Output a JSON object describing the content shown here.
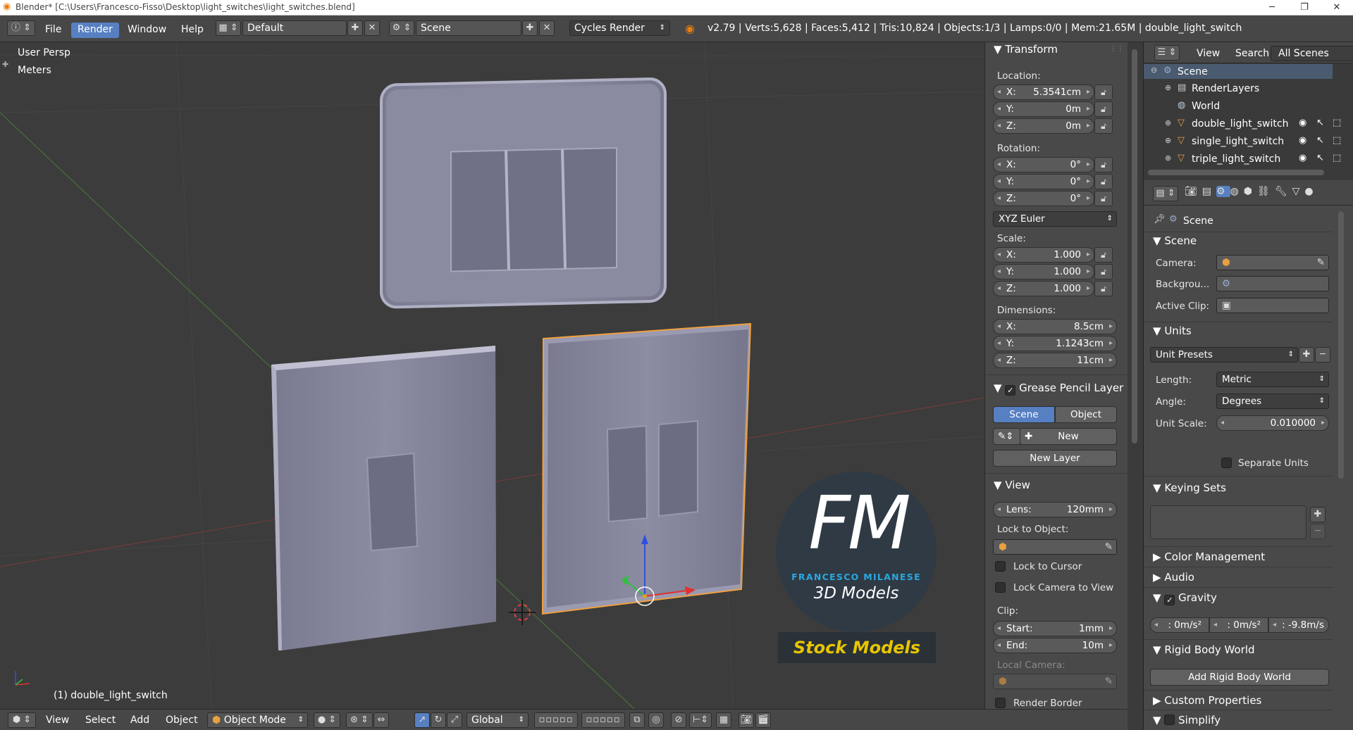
{
  "window": {
    "title": "Blender* [C:\\Users\\Francesco-Fisso\\Desktop\\light_switches\\light_switches.blend]",
    "minimize": "─",
    "maximize": "❐",
    "close": "✕"
  },
  "info_header": {
    "menus": [
      "File",
      "Render",
      "Window",
      "Help"
    ],
    "active_menu": "Render",
    "layout": "Default",
    "scene": "Scene",
    "engine": "Cycles Render",
    "stats": "v2.79 | Verts:5,628 | Faces:5,412 | Tris:10,824 | Objects:1/3 | Lamps:0/0 | Mem:21.65M | double_light_switch"
  },
  "viewport": {
    "view_name": "User Persp",
    "units": "Meters",
    "active_object": "(1) double_light_switch",
    "watermark": {
      "monogram": "FM",
      "name": "FRANCESCO MILANESE",
      "tagline": "3D Models",
      "banner": "Stock Models"
    }
  },
  "bottom_bar": {
    "menus": [
      "View",
      "Select",
      "Add",
      "Object"
    ],
    "mode": "Object Mode",
    "orientation": "Global"
  },
  "npanel": {
    "transform": {
      "title": "Transform",
      "location_label": "Location:",
      "location": [
        {
          "axis": "X:",
          "value": "5.3541cm"
        },
        {
          "axis": "Y:",
          "value": "0m"
        },
        {
          "axis": "Z:",
          "value": "0m"
        }
      ],
      "rotation_label": "Rotation:",
      "rotation": [
        {
          "axis": "X:",
          "value": "0°"
        },
        {
          "axis": "Y:",
          "value": "0°"
        },
        {
          "axis": "Z:",
          "value": "0°"
        }
      ],
      "rotation_mode": "XYZ Euler",
      "scale_label": "Scale:",
      "scale": [
        {
          "axis": "X:",
          "value": "1.000"
        },
        {
          "axis": "Y:",
          "value": "1.000"
        },
        {
          "axis": "Z:",
          "value": "1.000"
        }
      ],
      "dimensions_label": "Dimensions:",
      "dimensions": [
        {
          "axis": "X:",
          "value": "8.5cm"
        },
        {
          "axis": "Y:",
          "value": "1.1243cm"
        },
        {
          "axis": "Z:",
          "value": "11cm"
        }
      ]
    },
    "grease_pencil": {
      "title": "Grease Pencil Layer",
      "tab_scene": "Scene",
      "tab_object": "Object",
      "new": "New",
      "new_layer": "New Layer"
    },
    "view": {
      "title": "View",
      "lens_label": "Lens:",
      "lens": "120mm",
      "lock_to_object": "Lock to Object:",
      "lock_to_cursor": "Lock to Cursor",
      "lock_camera": "Lock Camera to View",
      "clip_label": "Clip:",
      "clip_start_label": "Start:",
      "clip_start": "1mm",
      "clip_end_label": "End:",
      "clip_end": "10m",
      "local_camera": "Local Camera:",
      "render_border": "Render Border"
    }
  },
  "outliner": {
    "menus": [
      "View",
      "Search"
    ],
    "filter": "All Scenes",
    "items": [
      {
        "label": "Scene",
        "icon": "scene-icon",
        "indent": 0
      },
      {
        "label": "RenderLayers",
        "icon": "renderlayers-icon",
        "indent": 1
      },
      {
        "label": "World",
        "icon": "world-icon",
        "indent": 1
      },
      {
        "label": "double_light_switch",
        "icon": "mesh-icon",
        "indent": 1
      },
      {
        "label": "single_light_switch",
        "icon": "mesh-icon",
        "indent": 1
      },
      {
        "label": "triple_light_switch",
        "icon": "mesh-icon",
        "indent": 1
      }
    ]
  },
  "properties": {
    "context": "Scene",
    "scene_panel": {
      "title": "Scene",
      "camera_label": "Camera:",
      "background_label": "Backgrou...",
      "active_clip_label": "Active Clip:"
    },
    "units_panel": {
      "title": "Units",
      "presets": "Unit Presets",
      "length_label": "Length:",
      "length": "Metric",
      "angle_label": "Angle:",
      "angle": "Degrees",
      "unit_scale_label": "Unit Scale:",
      "unit_scale": "0.010000",
      "separate_units": "Separate Units"
    },
    "keying_sets": {
      "title": "Keying Sets"
    },
    "color_management": {
      "title": "Color Management"
    },
    "audio": {
      "title": "Audio"
    },
    "gravity": {
      "title": "Gravity",
      "x": ": 0m/s²",
      "y": ": 0m/s²",
      "z": ": -9.8m/s"
    },
    "rigid_body": {
      "title": "Rigid Body World",
      "add": "Add Rigid Body World"
    },
    "custom_properties": {
      "title": "Custom Properties"
    },
    "simplify": {
      "title": "Simplify"
    }
  },
  "colors": {
    "accent": "#5680c2",
    "selection_outline": "#f0a040",
    "watermark_circle": "#2f3a44",
    "watermark_cyan": "#29a8e0",
    "watermark_yellow": "#e8c600"
  }
}
